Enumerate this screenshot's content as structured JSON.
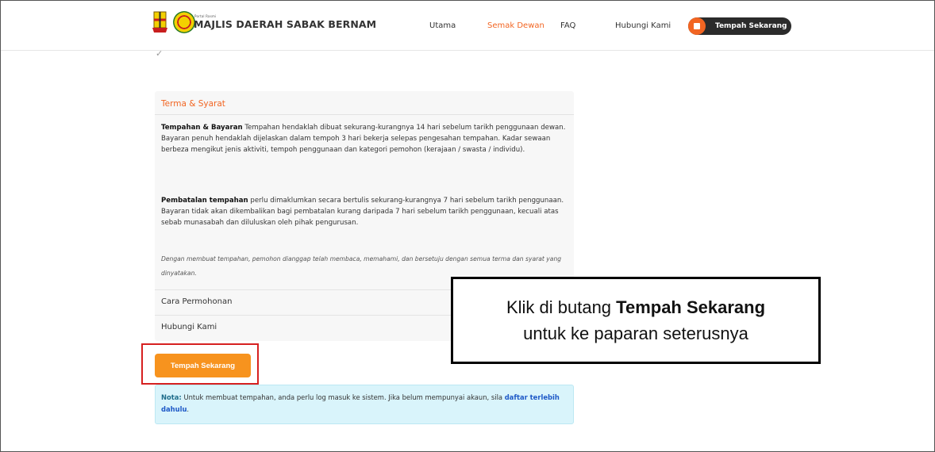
{
  "header": {
    "brand_small": "Portal Rasmi",
    "brand": "MAJLIS DAERAH SABAK BERNAM",
    "nav": [
      "Utama",
      "Semak Dewan",
      "FAQ",
      "Hubungi Kami"
    ],
    "book_button": "Tempah Sekarang"
  },
  "check_mark": "✓",
  "terms": {
    "title": "Terma & Syarat",
    "p1_bold": "Tempahan & Bayaran",
    "p1_text": " Tempahan hendaklah dibuat sekurang-kurangnya 14 hari sebelum tarikh penggunaan dewan. Bayaran penuh hendaklah dijelaskan dalam tempoh 3 hari bekerja selepas pengesahan tempahan. Kadar sewaan berbeza mengikut jenis aktiviti, tempoh penggunaan dan kategori pemohon (kerajaan / swasta / individu).",
    "p2_bold": "Pembatalan tempahan",
    "p2_text": " perlu dimaklumkan secara bertulis sekurang-kurangnya 7 hari sebelum tarikh penggunaan. Bayaran tidak akan dikembalikan bagi pembatalan kurang daripada 7 hari sebelum tarikh penggunaan, kecuali atas sebab munasabah dan diluluskan oleh pihak pengurusan.",
    "agreement": "Dengan membuat tempahan, pemohon dianggap telah membaca, memahami, dan bersetuju dengan semua terma dan syarat yang dinyatakan."
  },
  "accordion": [
    "Cara Permohonan",
    "Hubungi Kami"
  ],
  "tempah_button": "Tempah Sekarang",
  "info": {
    "label": "Nota:",
    "text": " Untuk membuat tempahan, anda perlu log masuk ke sistem. Jika belum mempunyai akaun, sila ",
    "link": "daftar terlebih dahulu",
    "end": "."
  },
  "callout": {
    "line1_pre": "Klik di butang ",
    "line1_bold": "Tempah Sekarang",
    "line2": "untuk ke paparan seterusnya"
  },
  "colors": {
    "accent": "#f26522",
    "button": "#f7931e",
    "info_bg": "#d9f4fb",
    "outline": "#d62020"
  }
}
